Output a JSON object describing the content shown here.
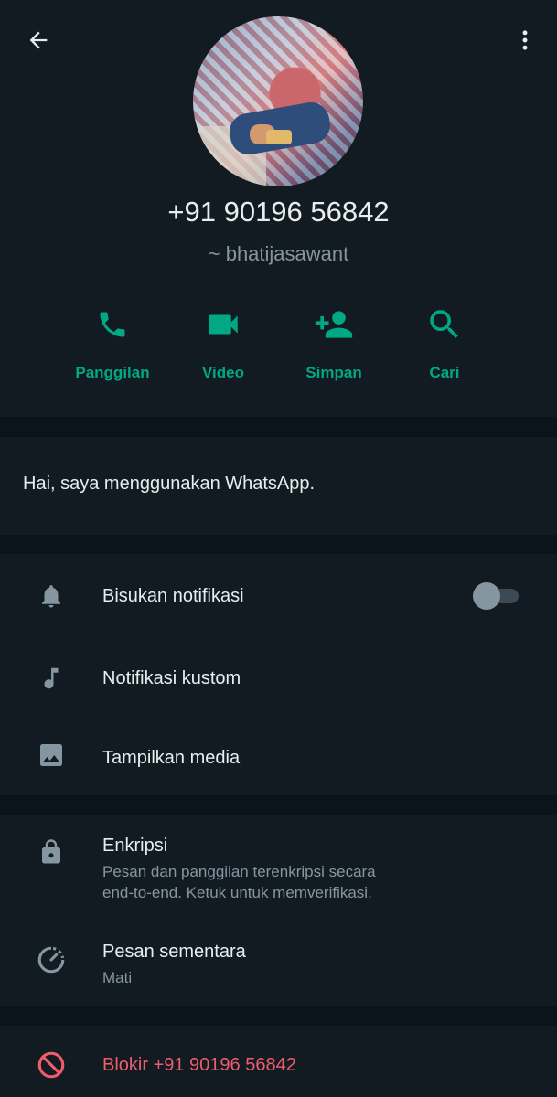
{
  "contact": {
    "phone": "+91 90196 56842",
    "username": "~ bhatijasawant"
  },
  "actions": [
    {
      "label": "Panggilan",
      "icon": "phone-icon"
    },
    {
      "label": "Video",
      "icon": "video-icon"
    },
    {
      "label": "Simpan",
      "icon": "add-person-icon"
    },
    {
      "label": "Cari",
      "icon": "search-icon"
    }
  ],
  "about": {
    "text": "Hai, saya menggunakan WhatsApp."
  },
  "settings": {
    "mute": {
      "label": "Bisukan notifikasi",
      "enabled": false
    },
    "custom_notif": {
      "label": "Notifikasi kustom"
    },
    "media": {
      "label": "Tampilkan media"
    }
  },
  "privacy": {
    "encryption": {
      "title": "Enkripsi",
      "line1": "Pesan dan panggilan terenkripsi secara",
      "line2": "end-to-end. Ketuk untuk memverifikasi."
    },
    "disappearing": {
      "title": "Pesan sementara",
      "value": "Mati"
    }
  },
  "block": {
    "label": "Blokir +91 90196 56842"
  },
  "colors": {
    "accent": "#00a884",
    "danger": "#f15c6d",
    "background": "#0b141a",
    "panel": "#111b21"
  }
}
